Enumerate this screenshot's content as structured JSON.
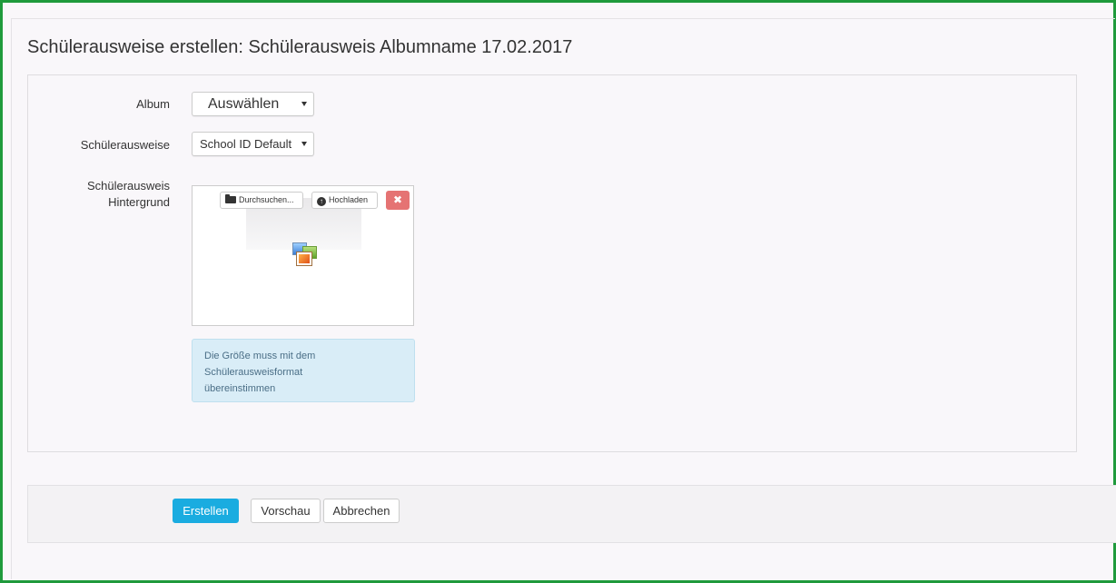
{
  "page": {
    "title": "Schülerausweise erstellen: Schülerausweis Albumname 17.02.2017"
  },
  "form": {
    "album": {
      "label": "Album",
      "selected": "Auswählen"
    },
    "schuelerausweise": {
      "label": "Schülerausweise",
      "selected": "School ID Default"
    },
    "background": {
      "label_line1": "Schülerausweis",
      "label_line2": "Hintergrund",
      "browse_label": "Durchsuchen...",
      "upload_label": "Hochladen",
      "delete_symbol": "✖",
      "info_line1": "Die Größe muss mit dem",
      "info_line2": "Schülerausweisformat",
      "info_line3": "übereinstimmen"
    }
  },
  "footer": {
    "create_label": "Erstellen",
    "preview_label": "Vorschau",
    "cancel_label": "Abbrechen"
  },
  "colors": {
    "frame_border": "#1f9a3c",
    "primary_button": "#1aace0",
    "delete_button": "#e57373",
    "info_background": "#d9edf7"
  },
  "icons": {
    "browse": "folder-open-icon",
    "upload": "upload-circle-icon",
    "delete": "close-icon",
    "placeholder": "image-placeholder-icon"
  }
}
